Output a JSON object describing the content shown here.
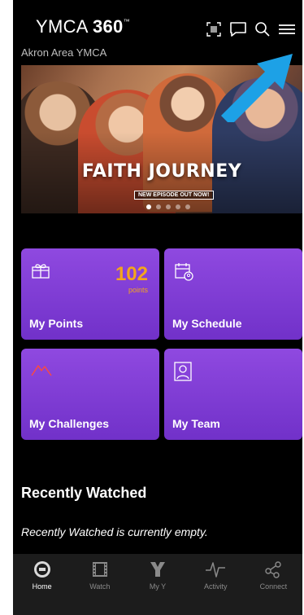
{
  "header": {
    "brand_prefix": "YMCA",
    "brand_bold": "360",
    "brand_mark": "™",
    "subtitle": "Akron Area YMCA",
    "icons": [
      "barcode-scan-icon",
      "chat-icon",
      "search-icon",
      "menu-icon"
    ]
  },
  "hero": {
    "title": "FAITH JOURNEY",
    "badge": "NEW EPISODE OUT NOW!",
    "slides": 5,
    "active_slide": 1
  },
  "tiles": {
    "points": {
      "label": "My Points",
      "value": "102",
      "unit": "points"
    },
    "schedule": {
      "label": "My Schedule"
    },
    "challenges": {
      "label": "My Challenges"
    },
    "team": {
      "label": "My Team"
    }
  },
  "recently_watched": {
    "title": "Recently Watched",
    "empty_message": "Recently Watched is currently empty."
  },
  "nav": {
    "items": [
      {
        "label": "Home",
        "icon": "home-360-icon",
        "active": true
      },
      {
        "label": "Watch",
        "icon": "film-icon",
        "active": false
      },
      {
        "label": "My Y",
        "icon": "y-logo-icon",
        "active": false
      },
      {
        "label": "Activity",
        "icon": "pulse-icon",
        "active": false
      },
      {
        "label": "Connect",
        "icon": "share-icon",
        "active": false
      }
    ]
  },
  "colors": {
    "background": "#000000",
    "tile_purple": "#7f3ad6",
    "points_orange": "#f4a51c",
    "challenge_red": "#ff4a3a",
    "annotation_arrow": "#1da1e6"
  }
}
